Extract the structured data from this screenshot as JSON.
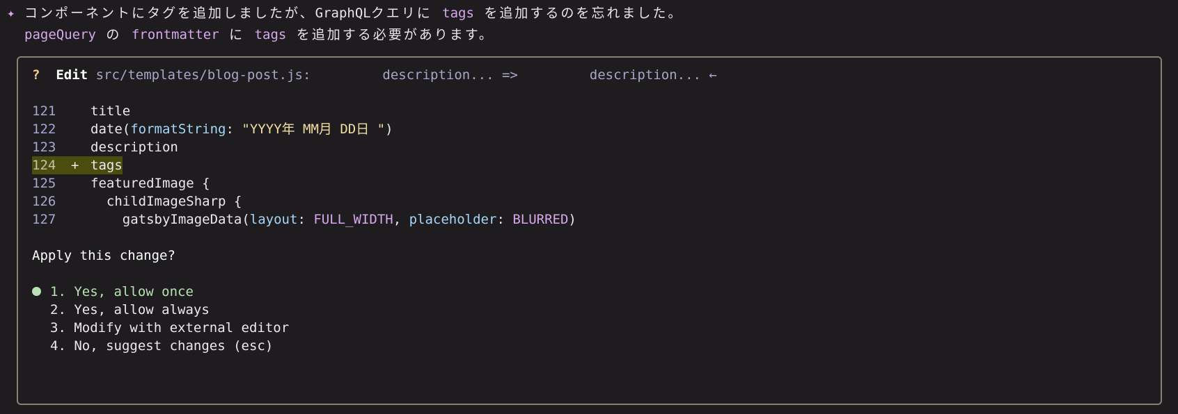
{
  "message": {
    "line1": {
      "prefix": "コンポーネントにタグを追加しましたが、",
      "graphql": "GraphQL",
      "mid": "クエリに ",
      "code": "tags",
      "suffix": " を追加するのを忘れました。"
    },
    "line2": {
      "code1": "pageQuery",
      "t1": " の ",
      "code2": "frontmatter",
      "t2": " に ",
      "code3": "tags",
      "t3": " を追加する必要があります。"
    }
  },
  "dialog": {
    "qmark": "?",
    "edit_label": "Edit",
    "file_path": "src/templates/blog-post.js:",
    "old_text": "description... =>",
    "new_text": "description... ←",
    "code_lines": [
      {
        "num": "121",
        "marker": "",
        "text": "title"
      },
      {
        "num": "122",
        "marker": "",
        "text": "date(formatString: \"YYYY年 MM月 DD日 \")"
      },
      {
        "num": "123",
        "marker": "",
        "text": "description"
      },
      {
        "num": "124",
        "marker": "+",
        "text": "tags"
      },
      {
        "num": "125",
        "marker": "",
        "text": "featuredImage {"
      },
      {
        "num": "126",
        "marker": "",
        "text": "  childImageSharp {"
      },
      {
        "num": "127",
        "marker": "",
        "text": "    gatsbyImageData(layout: FULL_WIDTH, placeholder: BLURRED)"
      }
    ],
    "code_parts": {
      "date_fn": "date(",
      "date_key": "formatString",
      "date_colon": ": ",
      "date_str": "\"YYYY年 MM月 DD日 \"",
      "date_close": ")",
      "gatsby_fn": "gatsbyImageData(",
      "layout_key": "layout",
      "colon": ": ",
      "layout_val": "FULL_WIDTH",
      "comma": ", ",
      "placeholder_key": "placeholder",
      "placeholder_val": "BLURRED",
      "gatsby_close": ")"
    },
    "question": "Apply this change?",
    "options": [
      {
        "label": "1. Yes, allow once",
        "selected": true
      },
      {
        "label": "2. Yes, allow always",
        "selected": false
      },
      {
        "label": "3. Modify with external editor",
        "selected": false
      },
      {
        "label": "4. No, suggest changes (esc)",
        "selected": false
      }
    ]
  },
  "colors": {
    "background": "#1e1c1f",
    "border": "#8a8170",
    "added_line_bg": "#4b4d0f",
    "selected_option": "#b8e2b4",
    "code_highlight": "#d6a8ec"
  }
}
